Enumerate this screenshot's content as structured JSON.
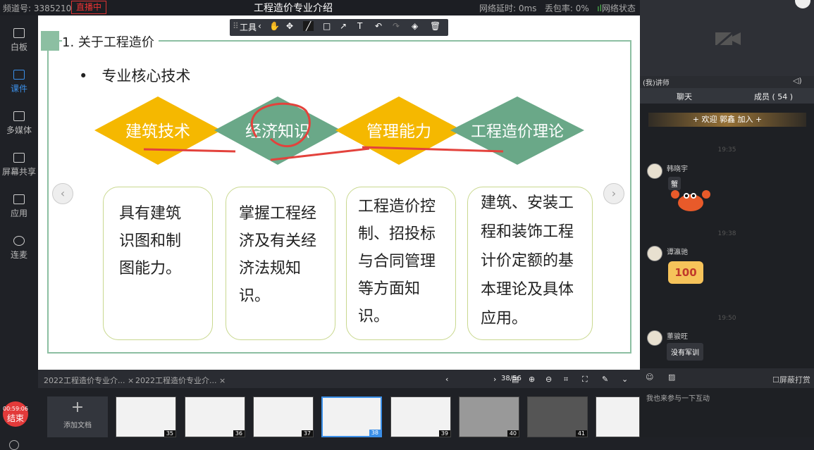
{
  "topbar": {
    "channel": "频道号: 3385210",
    "live_badge": "直播中",
    "title": "工程造价专业介绍",
    "net_delay": "网络延时: 0ms",
    "packet_loss": "丢包率: 0%",
    "net_status": "网络状态"
  },
  "sidebar": {
    "items": [
      "白板",
      "课件",
      "多媒体",
      "屏幕共享",
      "应用",
      "连麦"
    ],
    "timer": "00:59:06",
    "end_label": "结束"
  },
  "toolbar": {
    "label": "工具"
  },
  "slide": {
    "heading": "1. 关于工程造价",
    "bullet": "专业核心技术",
    "diamonds": [
      "建筑技术",
      "经济知识",
      "管理能力",
      "工程造价理论"
    ],
    "boxes": [
      [
        "具有建筑",
        "识图和制",
        "图能力。"
      ],
      [
        "掌握工程经",
        "济及有关经",
        "济法规知识。"
      ],
      [
        "工程造价控",
        "制、招投标",
        "与合同管理",
        "等方面知识。"
      ],
      [
        "建筑、安装工",
        "程和装饰工程",
        "计价定额的基",
        "本理论及具体",
        "应用。"
      ]
    ]
  },
  "bottom": {
    "tab1": "2022工程造价专业介... ×",
    "tab2": "2022工程造价专业介... ×",
    "page": "38/56",
    "add_doc": "添加文档",
    "thumb_numbers": [
      "35",
      "36",
      "37",
      "38",
      "39",
      "40",
      "41"
    ]
  },
  "right": {
    "teacher": "(我)讲师",
    "chat_tab": "聊天",
    "members_tab": "成员 ( 54 )",
    "welcome": "+ 欢迎 郭鑫 加入 +",
    "times": [
      "19:35",
      "19:38",
      "19:50"
    ],
    "messages": [
      {
        "name": "韩晓宇",
        "badge": "蟹"
      },
      {
        "name": "谭瀛驰",
        "sticker_text": "100"
      },
      {
        "name": "董骏旺",
        "text": "没有军训"
      }
    ],
    "screen_block": "屏蔽打赏",
    "input_placeholder": "我也来参与一下互动"
  },
  "colors": {
    "yellow": "#f5b800",
    "green": "#6aa888",
    "accent": "#3b8fe8",
    "ink": "#e3423c"
  }
}
